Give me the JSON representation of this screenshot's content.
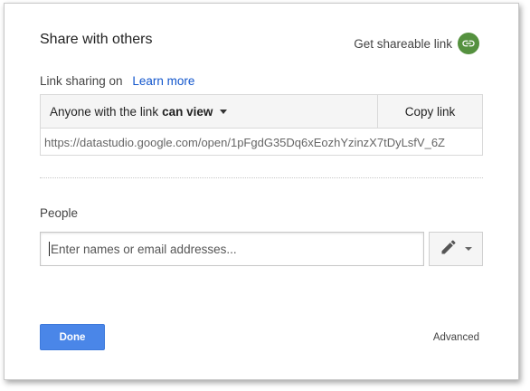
{
  "dialog": {
    "title": "Share with others",
    "get_link_label": "Get shareable link"
  },
  "link_sharing": {
    "status": "Link sharing on",
    "learn_more": "Learn more",
    "access_prefix": "Anyone with the link",
    "access_level": "can view",
    "copy_link": "Copy link",
    "url": "https://datastudio.google.com/open/1pFgdG35Dq6xEozhYzinzX7tDyLsfV_6Z"
  },
  "people": {
    "label": "People",
    "placeholder": "Enter names or email addresses..."
  },
  "footer": {
    "done": "Done",
    "advanced": "Advanced"
  },
  "colors": {
    "accent_blue": "#4a86e8",
    "link_blue": "#1155cc",
    "link_icon_green": "#55913f"
  },
  "icons": {
    "link": "link-icon",
    "edit": "pencil-icon",
    "dropdown": "caret-down-icon"
  }
}
